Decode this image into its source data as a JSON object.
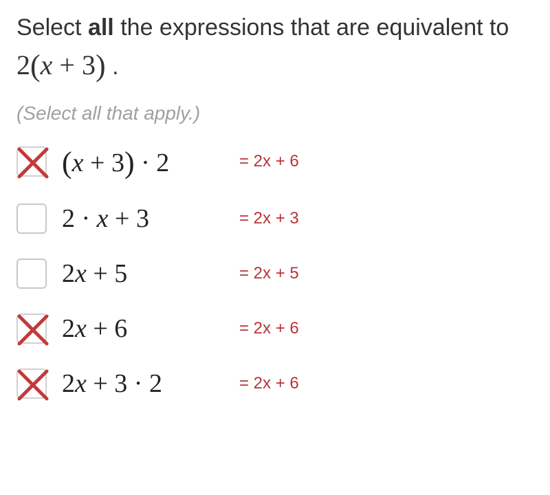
{
  "question": {
    "prefix": "Select ",
    "bold": "all",
    "mid": " the expressions that are equivalent to ",
    "expr_html": "2<span class='bigparen'>(</span><span class='it'>x</span>&nbsp;+&nbsp;3<span class='bigparen'>)</span>",
    "suffix": " ."
  },
  "hint": "(Select all that apply.)",
  "options": [
    {
      "checked": true,
      "expr_html": "<span class='bigp'>(</span><span class='it'>x</span>&nbsp;+&nbsp;3<span class='bigp'>)</span>&nbsp;·&nbsp;2",
      "annotation": "= 2x + 6"
    },
    {
      "checked": false,
      "expr_html": "2&nbsp;·&nbsp;<span class='it'>x</span>&nbsp;+&nbsp;3",
      "annotation": "= 2x + 3"
    },
    {
      "checked": false,
      "expr_html": "2<span class='it'>x</span>&nbsp;+&nbsp;5",
      "annotation": "= 2x + 5"
    },
    {
      "checked": true,
      "expr_html": "2<span class='it'>x</span>&nbsp;+&nbsp;6",
      "annotation": "= 2x + 6"
    },
    {
      "checked": true,
      "expr_html": "2<span class='it'>x</span>&nbsp;+&nbsp;3&nbsp;·&nbsp;2",
      "annotation": "= 2x + 6"
    }
  ]
}
